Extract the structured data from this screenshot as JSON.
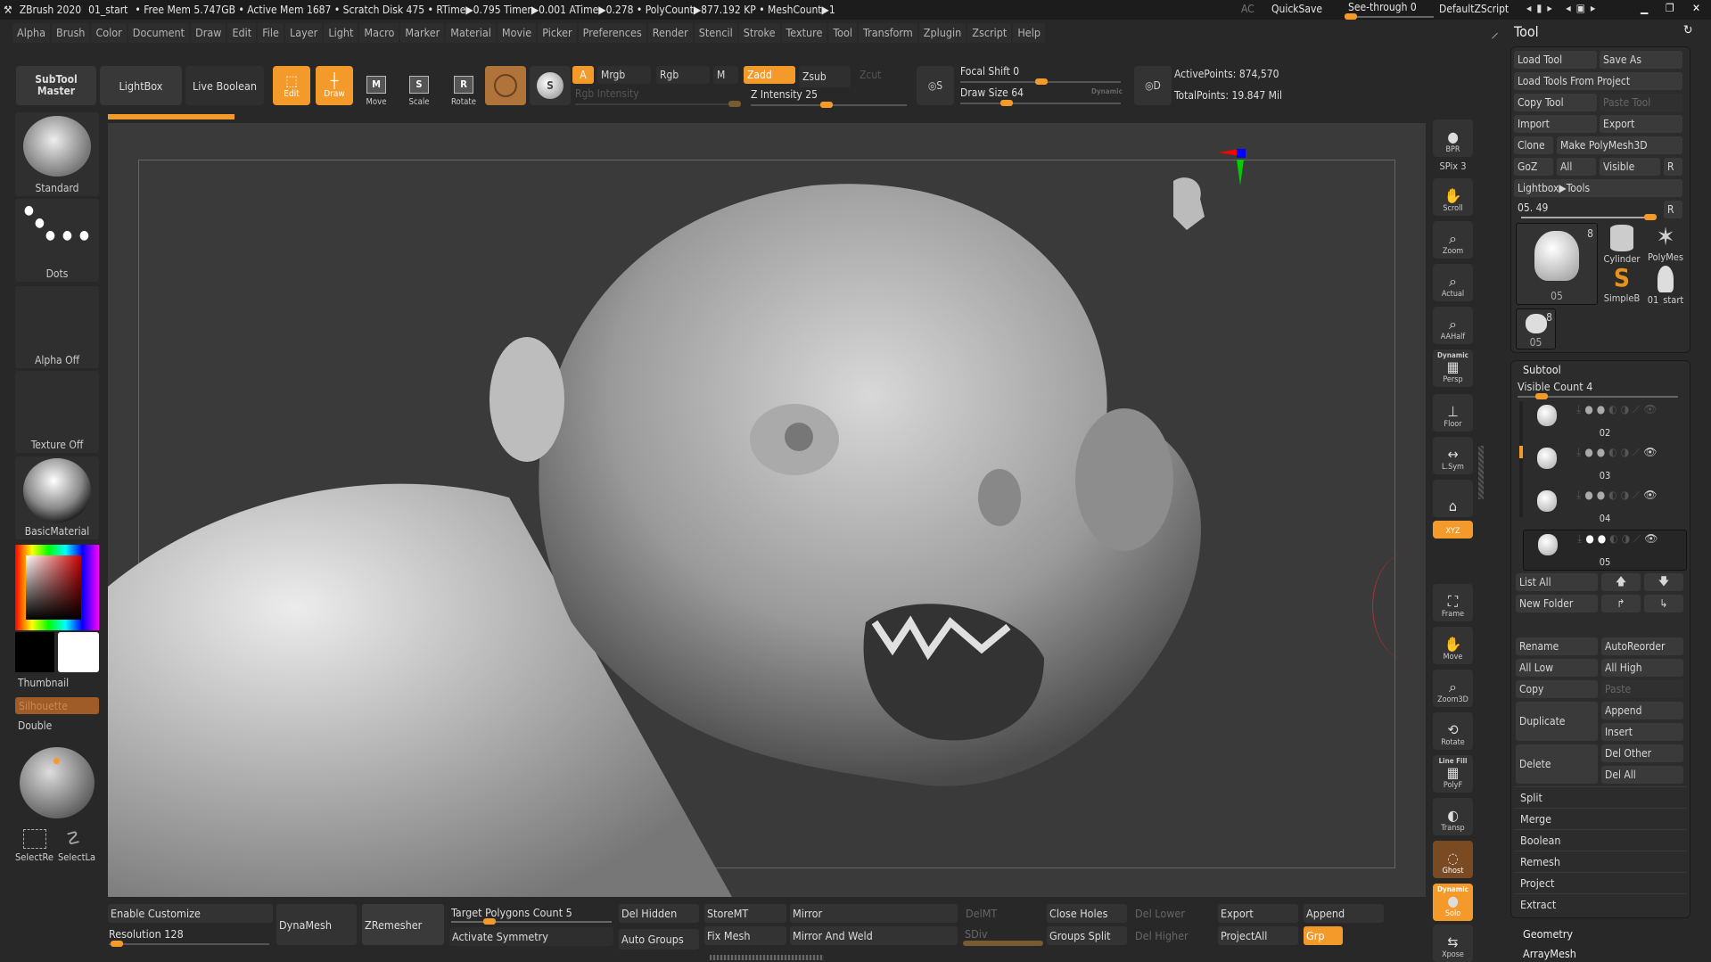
{
  "title": {
    "app": "ZBrush 2020",
    "doc": "01_start",
    "stats": "• Free Mem 5.747GB • Active Mem 1687 • Scratch Disk 475 • RTime▶0.795 Timer▶0.001 ATime▶0.278 • PolyCount▶877.192 KP • MeshCount▶1",
    "ac": "AC",
    "quicksave": "QuickSave",
    "seethrough": "See-through  0",
    "seethrough_value": 0,
    "defaultzscript": "DefaultZScript"
  },
  "menu": [
    "Alpha",
    "Brush",
    "Color",
    "Document",
    "Draw",
    "Edit",
    "File",
    "Layer",
    "Light",
    "Macro",
    "Marker",
    "Material",
    "Movie",
    "Picker",
    "Preferences",
    "Render",
    "Stencil",
    "Stroke",
    "Texture",
    "Tool",
    "Transform",
    "Zplugin",
    "Zscript",
    "Help"
  ],
  "toolbar": {
    "subtool_master": "SubTool Master",
    "lightbox": "LightBox",
    "live_boolean": "Live Boolean",
    "edit": "Edit",
    "draw": "Draw",
    "move": "Move",
    "scale": "Scale",
    "rotate": "Rotate",
    "a": "A",
    "mrgb": "Mrgb",
    "rgb": "Rgb",
    "m": "M",
    "zadd": "Zadd",
    "zsub": "Zsub",
    "zcut": "Zcut",
    "rgb_intensity": "Rgb Intensity",
    "z_intensity": "Z Intensity 25",
    "z_intensity_value": 25,
    "focal_shift": "Focal Shift 0",
    "focal_shift_value": 0,
    "draw_size": "Draw Size 64",
    "draw_size_value": 64,
    "dynamic": "Dynamic",
    "active_points": "ActivePoints: 874,570",
    "total_points": "TotalPoints: 19.847 Mil"
  },
  "left": {
    "brush": "Standard",
    "stroke": "Dots",
    "alpha": "Alpha Off",
    "texture": "Texture Off",
    "material": "BasicMaterial",
    "thumbnail": "Thumbnail",
    "silhouette": "Silhouette",
    "double": "Double",
    "select_rect": "SelectRe",
    "select_lasso": "SelectLa"
  },
  "shelf": [
    {
      "label": "BPR"
    },
    {
      "label": "SPix 3"
    },
    {
      "label": "Scroll"
    },
    {
      "label": "Zoom"
    },
    {
      "label": "Actual"
    },
    {
      "label": "AAHalf"
    },
    {
      "label": "Persp",
      "top": "Dynamic"
    },
    {
      "label": "Floor"
    },
    {
      "label": "L.Sym"
    },
    {
      "label": ""
    },
    {
      "label": "XYZ"
    },
    {
      "label": "Frame"
    },
    {
      "label": "Move"
    },
    {
      "label": "Zoom3D"
    },
    {
      "label": "Rotate"
    },
    {
      "label": "PolyF",
      "top": "Line Fill"
    },
    {
      "label": "Transp"
    },
    {
      "label": "Ghost"
    },
    {
      "label": "Solo",
      "top": "Dynamic"
    },
    {
      "label": "Xpose"
    }
  ],
  "tool": {
    "title": "Tool",
    "load_tool": "Load Tool",
    "save_as": "Save As",
    "load_from_project": "Load Tools From Project",
    "copy_tool": "Copy Tool",
    "paste_tool": "Paste Tool",
    "import": "Import",
    "export": "Export",
    "clone": "Clone",
    "make_polymesh": "Make PolyMesh3D",
    "goz": "GoZ",
    "all": "All",
    "visible": "Visible",
    "r": "R",
    "lightbox_tools": "Lightbox▶Tools",
    "current": "05. 49",
    "thumbs": [
      {
        "name": "05",
        "count": "8"
      },
      {
        "name": "Cylinder"
      },
      {
        "name": "PolyMes"
      },
      {
        "name": "SimpleB"
      },
      {
        "name": "01_start"
      },
      {
        "name": "05",
        "count": "8"
      }
    ]
  },
  "subtool": {
    "title": "Subtool",
    "visible_count": "Visible Count 4",
    "items": [
      "02",
      "03",
      "04",
      "05"
    ],
    "list_all": "List All",
    "new_folder": "New Folder",
    "rename": "Rename",
    "autoreorder": "AutoReorder",
    "all_low": "All Low",
    "all_high": "All High",
    "copy": "Copy",
    "paste": "Paste",
    "duplicate": "Duplicate",
    "append": "Append",
    "insert": "Insert",
    "delete": "Delete",
    "del_other": "Del Other",
    "del_all": "Del All",
    "sections": [
      "Split",
      "Merge",
      "Boolean",
      "Remesh",
      "Project",
      "Extract"
    ]
  },
  "more": [
    "Geometry",
    "ArrayMesh"
  ],
  "bottom": {
    "enable_customize": "Enable Customize",
    "resolution": "Resolution 128",
    "resolution_value": 128,
    "dynamesh": "DynaMesh",
    "zremesher": "ZRemesher",
    "target_polygons": "Target Polygons Count 5",
    "target_value": 5,
    "activate_symmetry": "Activate Symmetry",
    "del_hidden": "Del Hidden",
    "auto_groups": "Auto Groups",
    "storemt": "StoreMT",
    "fix_mesh": "Fix Mesh",
    "mirror": "Mirror",
    "mirror_weld": "Mirror And Weld",
    "delmt": "DelMT",
    "sdiv": "SDiv",
    "close_holes": "Close Holes",
    "groups_split": "Groups Split",
    "del_lower": "Del Lower",
    "del_higher": "Del Higher",
    "export": "Export",
    "projectall": "ProjectAll",
    "append": "Append",
    "grp": "Grp"
  },
  "colors": {
    "accent": "#f39a2b",
    "bg": "#282828",
    "panel": "#3a3a3a"
  }
}
